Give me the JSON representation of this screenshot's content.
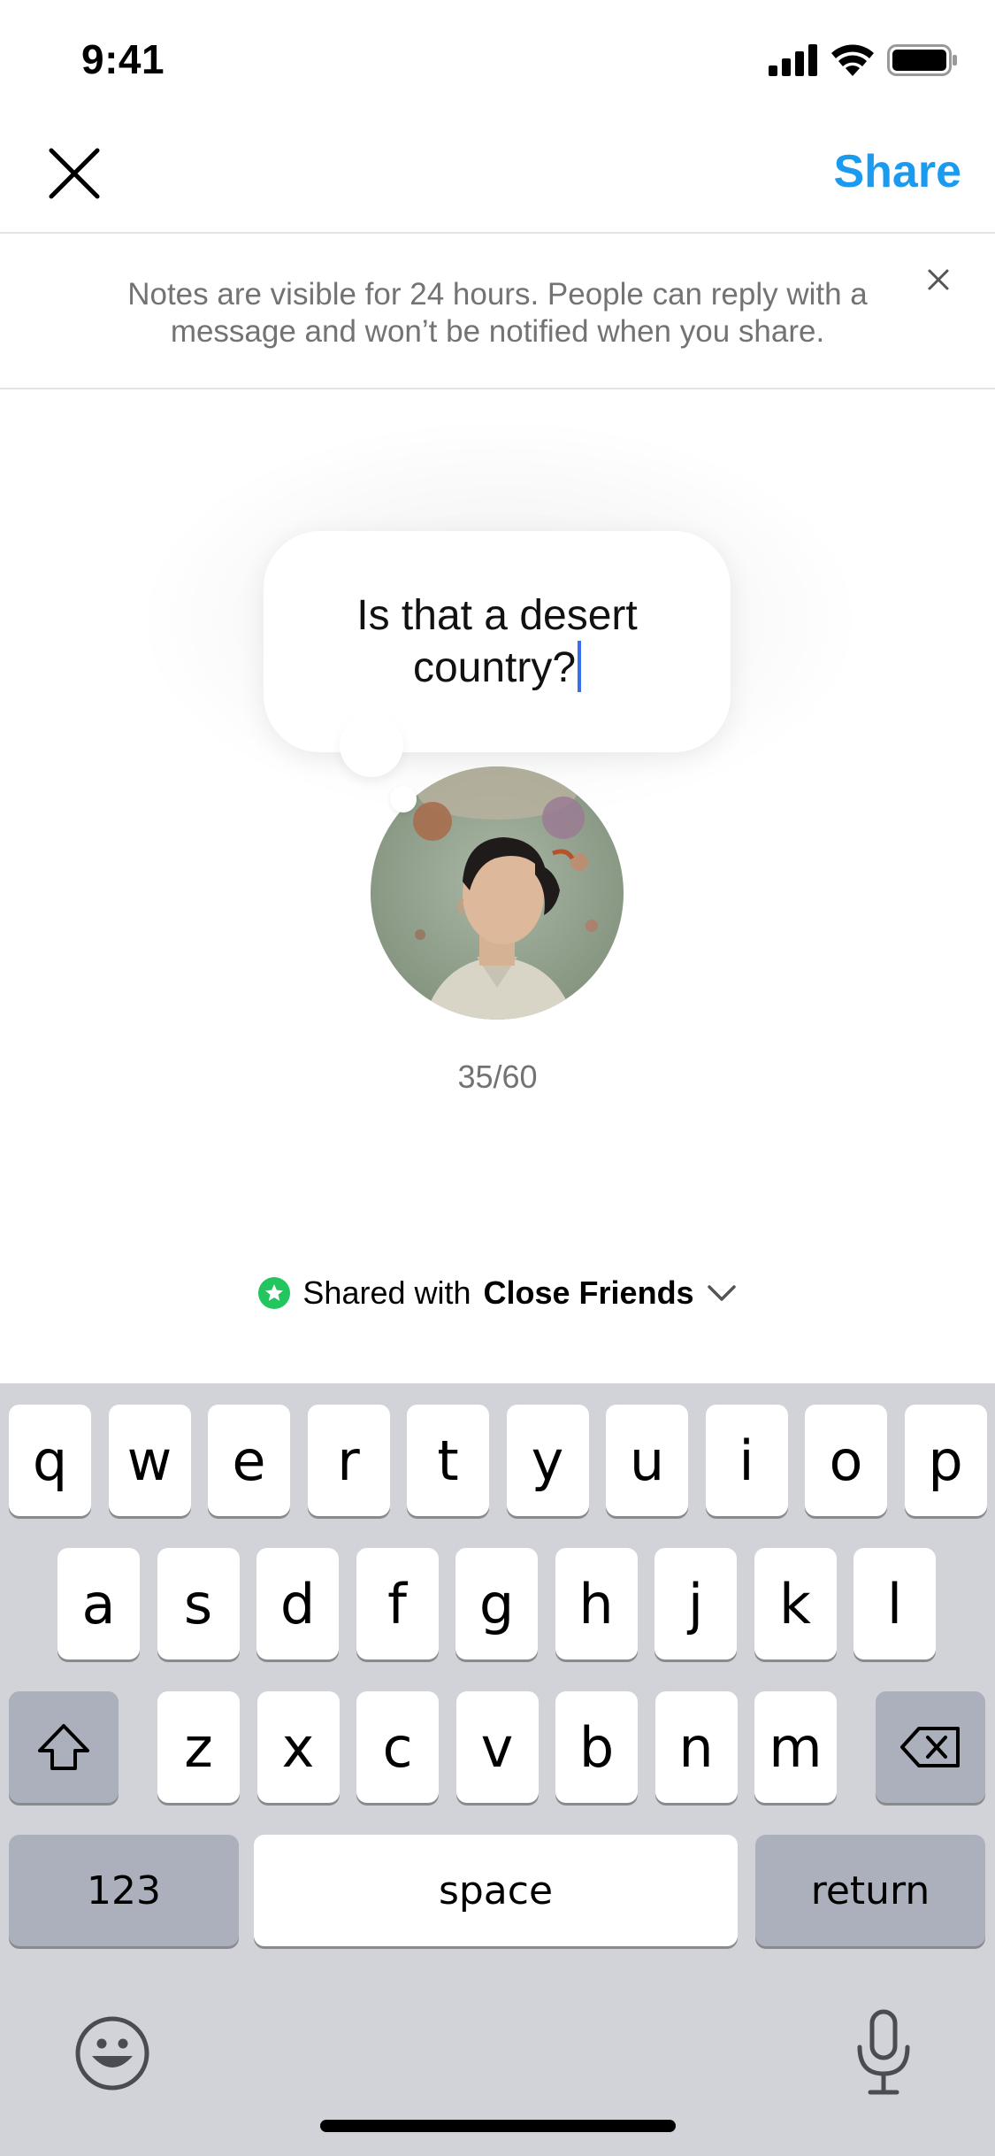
{
  "status_bar": {
    "time": "9:41",
    "icons": [
      "signal-icon",
      "wifi-icon",
      "battery-icon"
    ]
  },
  "nav": {
    "close_icon": "close-icon",
    "share_label": "Share"
  },
  "banner": {
    "text": "Notes are visible for 24 hours. People can reply with a message and won’t be notified when you share.",
    "close_icon": "close-icon"
  },
  "note": {
    "text": "Is that a desert country?",
    "counter": "35/60"
  },
  "audience": {
    "prefix": "Shared with",
    "group": "Close Friends",
    "icon": "close-friends-star-icon",
    "chevron": "chevron-down-icon"
  },
  "keyboard": {
    "row1": [
      "q",
      "w",
      "e",
      "r",
      "t",
      "y",
      "u",
      "i",
      "o",
      "p"
    ],
    "row2": [
      "a",
      "s",
      "d",
      "f",
      "g",
      "h",
      "j",
      "k",
      "l"
    ],
    "row3": [
      "z",
      "x",
      "c",
      "v",
      "b",
      "n",
      "m"
    ],
    "numbers_label": "123",
    "space_label": "space",
    "return_label": "return",
    "shift_icon": "shift-icon",
    "delete_icon": "backspace-icon",
    "emoji_icon": "emoji-icon",
    "mic_icon": "microphone-icon"
  },
  "colors": {
    "accent": "#1a9bf0",
    "close_friends": "#22c55e",
    "caret": "#3b6df1",
    "keyboard_bg": "#d1d3d9"
  }
}
